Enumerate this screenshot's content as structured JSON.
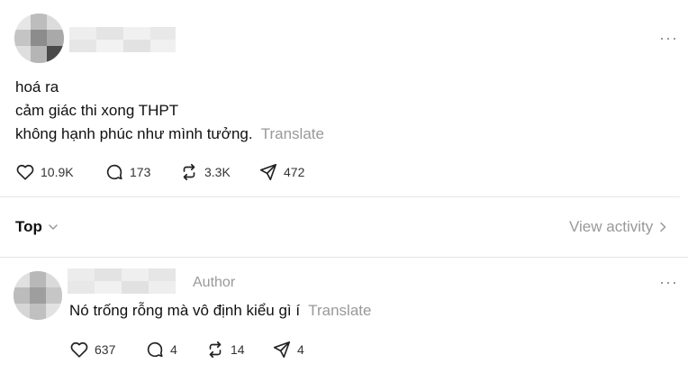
{
  "post": {
    "lines": [
      "hoá ra",
      "cảm giác thi xong THPT",
      "không hạnh phúc như mình tưởng."
    ],
    "translate_label": "Translate",
    "more_label": "···",
    "actions": {
      "likes": "10.9K",
      "replies": "173",
      "reposts": "3.3K",
      "shares": "472"
    }
  },
  "replies_header": {
    "sort_label": "Top",
    "view_activity_label": "View activity"
  },
  "reply": {
    "author_badge": "Author",
    "text": "Nó trống rỗng mà vô định kiểu gì í",
    "translate_label": "Translate",
    "more_label": "···",
    "actions": {
      "likes": "637",
      "replies": "4",
      "reposts": "14",
      "shares": "4"
    }
  },
  "icons": [
    "heart-icon",
    "comment-icon",
    "repost-icon",
    "share-icon",
    "chevron-down-icon",
    "chevron-right-icon"
  ]
}
